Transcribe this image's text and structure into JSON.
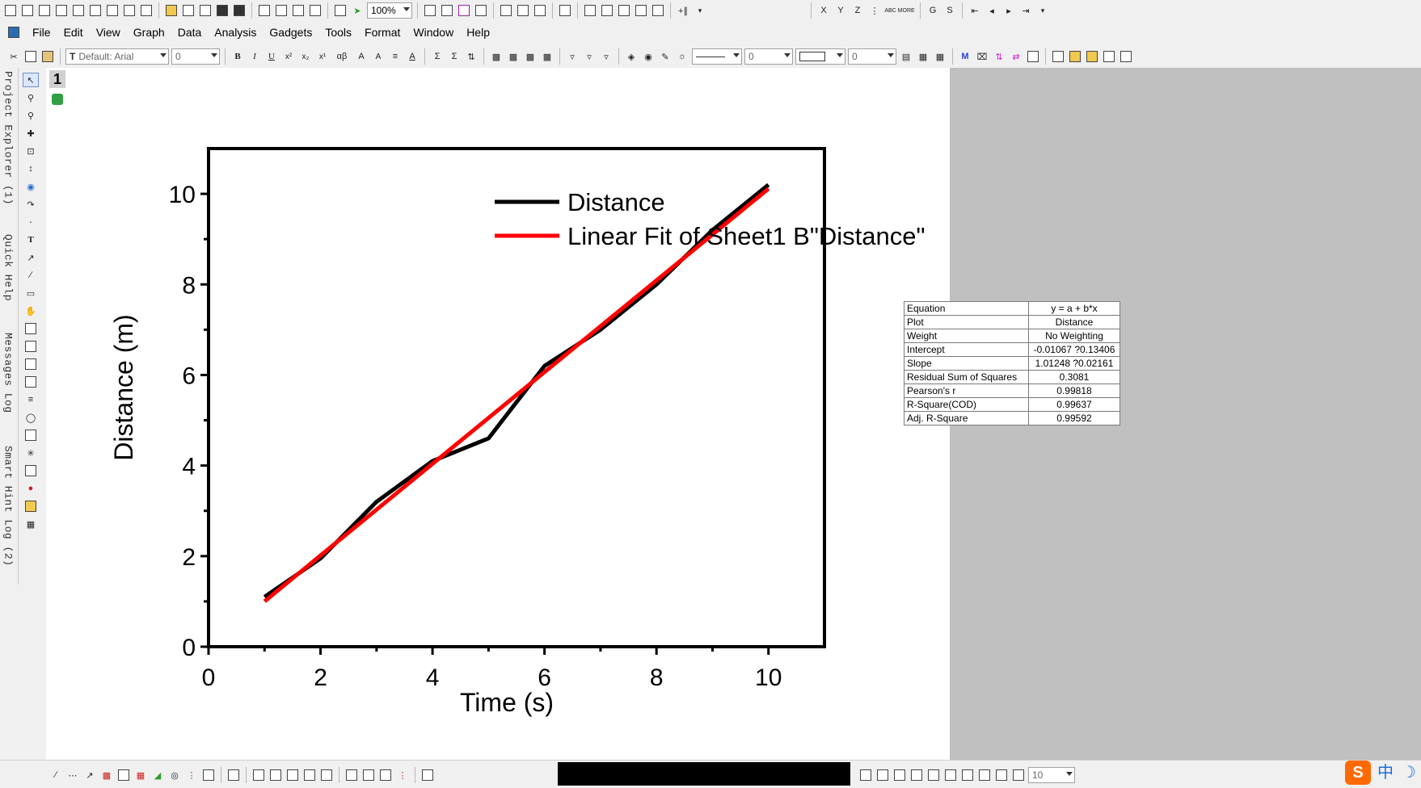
{
  "toolbar_top": {
    "zoom": "100%",
    "xyz_labels": [
      "X",
      "Y",
      "Z"
    ],
    "gs_labels": [
      "G",
      "S"
    ],
    "abc_label": "ABC MORE"
  },
  "menu": {
    "items": [
      "File",
      "Edit",
      "View",
      "Graph",
      "Data",
      "Analysis",
      "Gadgets",
      "Tools",
      "Format",
      "Window",
      "Help"
    ]
  },
  "format_toolbar": {
    "font": "Default: Arial",
    "font_size": "0",
    "alpha_beta": "αβ",
    "line_width": "0",
    "border_width": "0"
  },
  "side_tabs": [
    "Project Explorer (1)",
    "Quick Help",
    "Messages Log",
    "Smart Hint Log (2)"
  ],
  "layer_number": "1",
  "chart_data": {
    "type": "line",
    "xlabel": "Time (s)",
    "ylabel": "Distance (m)",
    "xlim": [
      0,
      11
    ],
    "ylim": [
      0,
      11
    ],
    "x_ticks": [
      "0",
      "2",
      "4",
      "6",
      "8",
      "10"
    ],
    "y_ticks": [
      "0",
      "2",
      "4",
      "6",
      "8",
      "10"
    ],
    "legend_placement": "top-right",
    "series": [
      {
        "name": "Distance",
        "color": "#000000",
        "x": [
          1,
          2,
          3,
          4,
          5,
          6,
          7,
          8,
          9,
          10
        ],
        "y": [
          1.1,
          1.95,
          3.2,
          4.1,
          4.6,
          6.2,
          7.0,
          8.0,
          9.2,
          10.2
        ]
      },
      {
        "name": "Linear Fit of Sheet1 B\"Distance\"",
        "color": "#ff0000",
        "x": [
          1,
          10
        ],
        "y": [
          1.00181,
          10.11413
        ]
      }
    ]
  },
  "fit_table": [
    [
      "Equation",
      "y = a + b*x"
    ],
    [
      "Plot",
      "Distance"
    ],
    [
      "Weight",
      "No Weighting"
    ],
    [
      "Intercept",
      "-0.01067 ?0.13406"
    ],
    [
      "Slope",
      "1.01248 ?0.02161"
    ],
    [
      "Residual Sum of Squares",
      "0.3081"
    ],
    [
      "Pearson's r",
      "0.99818"
    ],
    [
      "R-Square(COD)",
      "0.99637"
    ],
    [
      "Adj. R-Square",
      "0.99592"
    ]
  ],
  "bottom_toolbar": {
    "size_value": "10"
  },
  "ime": {
    "chinese_char": "中",
    "moon": "☽"
  }
}
